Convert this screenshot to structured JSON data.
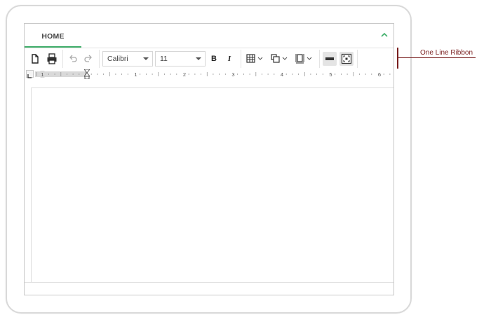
{
  "tabs": [
    {
      "label": "HOME"
    }
  ],
  "ribbon": {
    "font_name": "Calibri",
    "font_size": "11",
    "bold_label": "B",
    "italic_label": "I"
  },
  "ruler": {
    "numbers": [
      "1",
      "1",
      "2",
      "3",
      "4",
      "5",
      "6"
    ]
  },
  "annotation": {
    "label": "One Line Ribbon"
  },
  "colors": {
    "accent_green": "#3fae6a",
    "callout": "#7a1f1f"
  },
  "icons": [
    "new-document-icon",
    "print-icon",
    "undo-icon",
    "redo-icon",
    "table-icon",
    "picture-icon",
    "page-layout-icon",
    "ruler-toggle-icon",
    "fullscreen-icon",
    "collapse-ribbon-icon"
  ]
}
